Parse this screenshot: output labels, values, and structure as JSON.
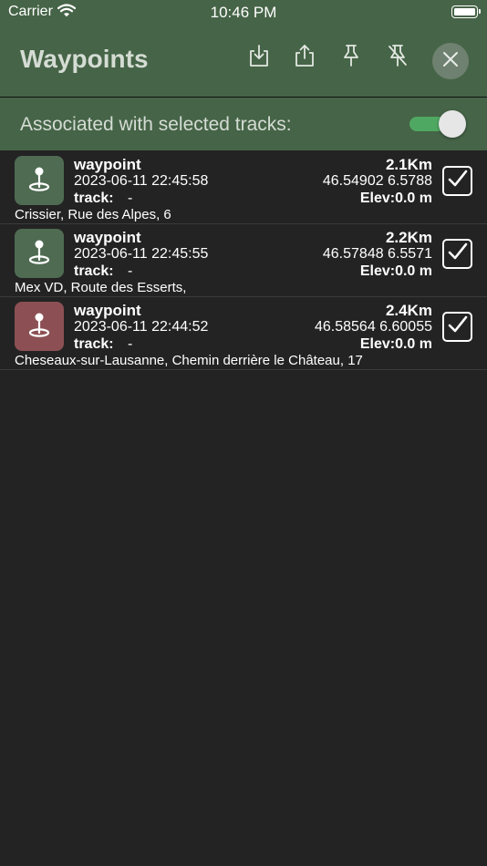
{
  "status_bar": {
    "carrier": "Carrier",
    "time": "10:46 PM"
  },
  "header": {
    "title": "Waypoints",
    "icons": [
      "import-icon",
      "share-icon",
      "pin-icon",
      "pin-off-icon",
      "close-icon"
    ]
  },
  "association": {
    "label": "Associated with selected tracks:",
    "toggle_on": true
  },
  "colors": {
    "header_bg": "#466447",
    "list_bg": "#232323",
    "icon_green": "#4f6b52",
    "icon_red": "#8c5054",
    "toggle_on": "#4fa862"
  },
  "waypoints": [
    {
      "name": "waypoint",
      "datetime": "2023-06-11 22:45:58",
      "track_label": "track:",
      "track_value": "-",
      "distance": "2.1Km",
      "coords": "46.54902 6.5788",
      "elevation": "Elev:0.0 m",
      "address": "Crissier, Rue des Alpes, 6",
      "icon_color": "#4f6b52",
      "checked": true
    },
    {
      "name": "waypoint",
      "datetime": "2023-06-11 22:45:55",
      "track_label": "track:",
      "track_value": "-",
      "distance": "2.2Km",
      "coords": "46.57848 6.5571",
      "elevation": "Elev:0.0 m",
      "address": "Mex VD, Route des Esserts,",
      "icon_color": "#4f6b52",
      "checked": true
    },
    {
      "name": "waypoint",
      "datetime": "2023-06-11 22:44:52",
      "track_label": "track:",
      "track_value": "-",
      "distance": "2.4Km",
      "coords": "46.58564 6.60055",
      "elevation": "Elev:0.0 m",
      "address": "Cheseaux-sur-Lausanne, Chemin derrière le Château, 17",
      "icon_color": "#8c5054",
      "checked": true
    }
  ]
}
